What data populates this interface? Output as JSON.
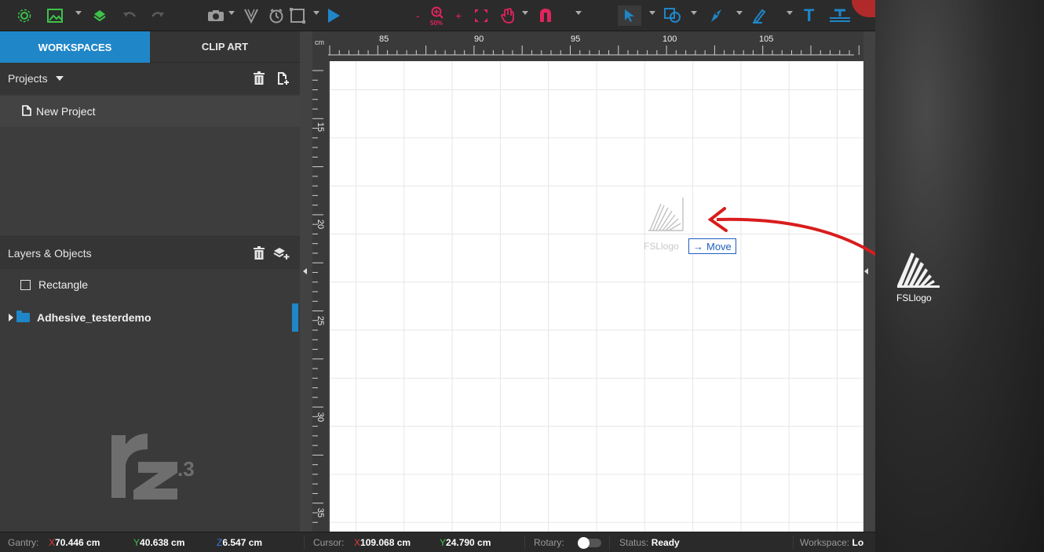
{
  "toolbar": {
    "zoom_label": "50%"
  },
  "tabs": {
    "workspaces": "WORKSPACES",
    "clip_art": "CLIP ART"
  },
  "projects": {
    "header": "Projects",
    "items": [
      "New Project"
    ]
  },
  "layers": {
    "header": "Layers & Objects",
    "items": [
      "Rectangle",
      "Adhesive_testerdemo"
    ]
  },
  "brand": {
    "logo_text": "rz.3"
  },
  "ruler": {
    "unit": "cm",
    "top": [
      "85",
      "90",
      "95",
      "100",
      "105"
    ],
    "left": [
      "15",
      "20",
      "25",
      "30",
      "35"
    ]
  },
  "drag": {
    "ghost_label": "FSLlogo",
    "tooltip": "Move"
  },
  "desktop": {
    "icon_label": "FSLlogo",
    "icon_name": "fsl-logo-icon"
  },
  "status": {
    "gantry_label": "Gantry:",
    "gantry_x_label": "X",
    "gantry_x": "70.446 cm",
    "gantry_y_label": "Y",
    "gantry_y": "40.638 cm",
    "gantry_z_label": "Z",
    "gantry_z": "6.547 cm",
    "cursor_label": "Cursor:",
    "cursor_x_label": "X",
    "cursor_x": "109.068 cm",
    "cursor_y_label": "Y",
    "cursor_y": "24.790 cm",
    "rotary_label": "Rotary:",
    "status_label": "Status:",
    "status_value": "Ready",
    "workspace_label": "Workspace:",
    "workspace_value": "Lo"
  },
  "colors": {
    "accent": "#1f86c8",
    "zoom_pink": "#e0245e",
    "arrow_red": "#d91c1c"
  }
}
